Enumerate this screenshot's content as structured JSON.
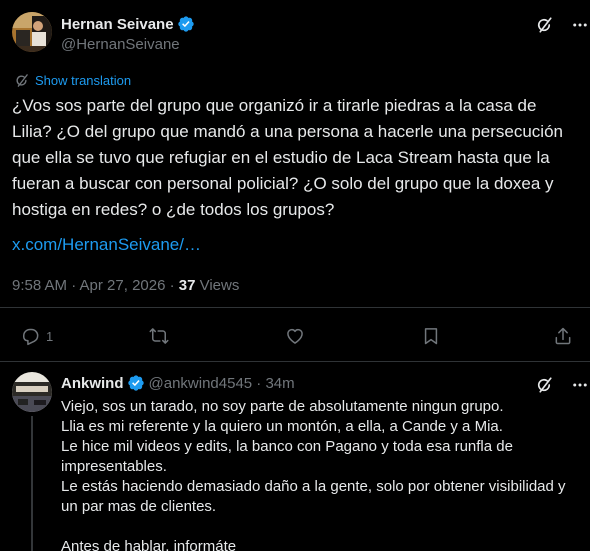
{
  "main_tweet": {
    "author_name": "Hernan Seivane",
    "handle": "@HernanSeivane",
    "show_translation": "Show translation",
    "text": "¿Vos sos parte del grupo que organizó ir a tirarle piedras a la casa de Lilia? ¿O del grupo que mandó a una persona a hacerle una persecución que ella se tuvo que refugiar en el estudio de Laca Stream hasta que la fueran a buscar con personal policial? ¿O solo del grupo que la doxea y hostiga en redes? o ¿de todos los grupos?",
    "link": "x.com/HernanSeivane/…",
    "timestamp": "9:58 AM · Apr 27, 2026 · ",
    "views_count": "37",
    "views_label": " Views",
    "replies_count": "1"
  },
  "reply": {
    "author_name": "Ankwind",
    "handle": "@ankwind4545 · 34m",
    "lines": [
      "Viejo, sos un tarado, no soy parte de absolutamente ningun grupo.",
      "Llia es mi referente y la quiero un montón, a ella, a Cande y a Mia.",
      "Le hice mil videos y edits, la banco con Pagano y toda esa runfla de impresentables.",
      "Le estás haciendo demasiado daño a la gente, solo por obtener visibilidad y un par mas de clientes.",
      "",
      "Antes de hablar, informáte"
    ]
  },
  "colors": {
    "background": "#000000",
    "text": "#e7e9ea",
    "secondary": "#71767b",
    "accent": "#1d9bf0",
    "divider": "#2f3336"
  },
  "icons": [
    "verified-badge-icon",
    "grok-icon",
    "more-icon",
    "translate-icon",
    "reply-icon",
    "retweet-icon",
    "like-icon",
    "bookmark-icon",
    "share-icon"
  ]
}
